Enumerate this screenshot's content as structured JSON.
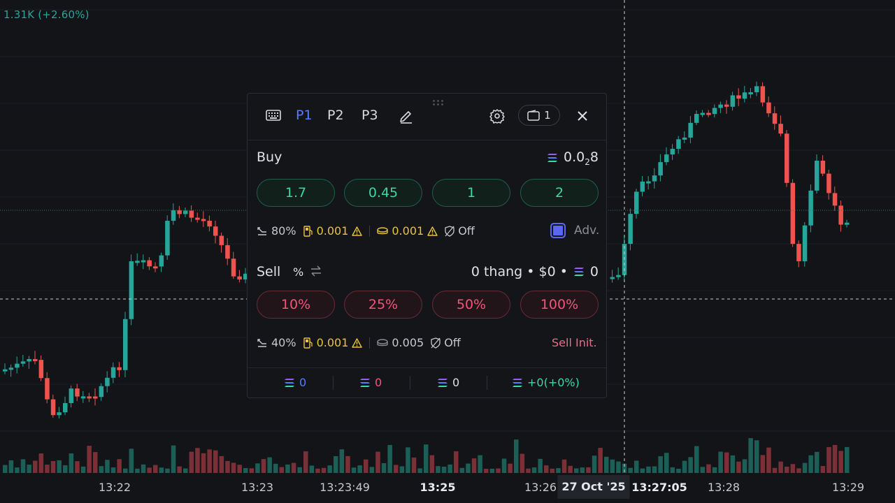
{
  "header": {
    "change": "1.31K (+2.60%)"
  },
  "axis": {
    "times": [
      "13:22",
      "13:23",
      "13:23:49",
      "13:25",
      "13:26",
      "13:27:05",
      "13:28",
      "13:29"
    ],
    "crosshair_date": "27 Oct '25"
  },
  "panel": {
    "tabs": [
      "P1",
      "P2",
      "P3"
    ],
    "wallet_count": "1",
    "buy": {
      "label": "Buy",
      "balance_prefix": "0.0",
      "balance_subscript": "2",
      "balance_suffix": "8",
      "amounts": [
        "1.7",
        "0.45",
        "1",
        "2"
      ],
      "slippage": "80%",
      "priority_fee": "0.001",
      "bribe": "0.001",
      "mev": "Off",
      "advanced_label": "Adv."
    },
    "sell": {
      "label": "Sell",
      "percent_symbol": "%",
      "position": "0 thang • $0 •",
      "position_sol": "0",
      "amounts": [
        "10%",
        "25%",
        "50%",
        "100%"
      ],
      "slippage": "40%",
      "priority_fee": "0.001",
      "bribe": "0.005",
      "mev": "Off",
      "init_label": "Sell Init."
    },
    "footer": [
      "0",
      "0",
      "0",
      "+0(+0%)"
    ]
  },
  "colors": {
    "up": "#26a69a",
    "down": "#ef5350",
    "accent": "#5b7cfa",
    "buy_text": "#3ad9a5",
    "sell_text": "#f2557a",
    "warning": "#e8c33c"
  },
  "icons": [
    "keyboard-icon",
    "pencil-icon",
    "gear-icon",
    "wallet-icon",
    "close-icon",
    "solana-icon",
    "slippage-icon",
    "gas-icon",
    "coins-icon",
    "warning-icon",
    "shield-off-icon",
    "swap-icon"
  ]
}
